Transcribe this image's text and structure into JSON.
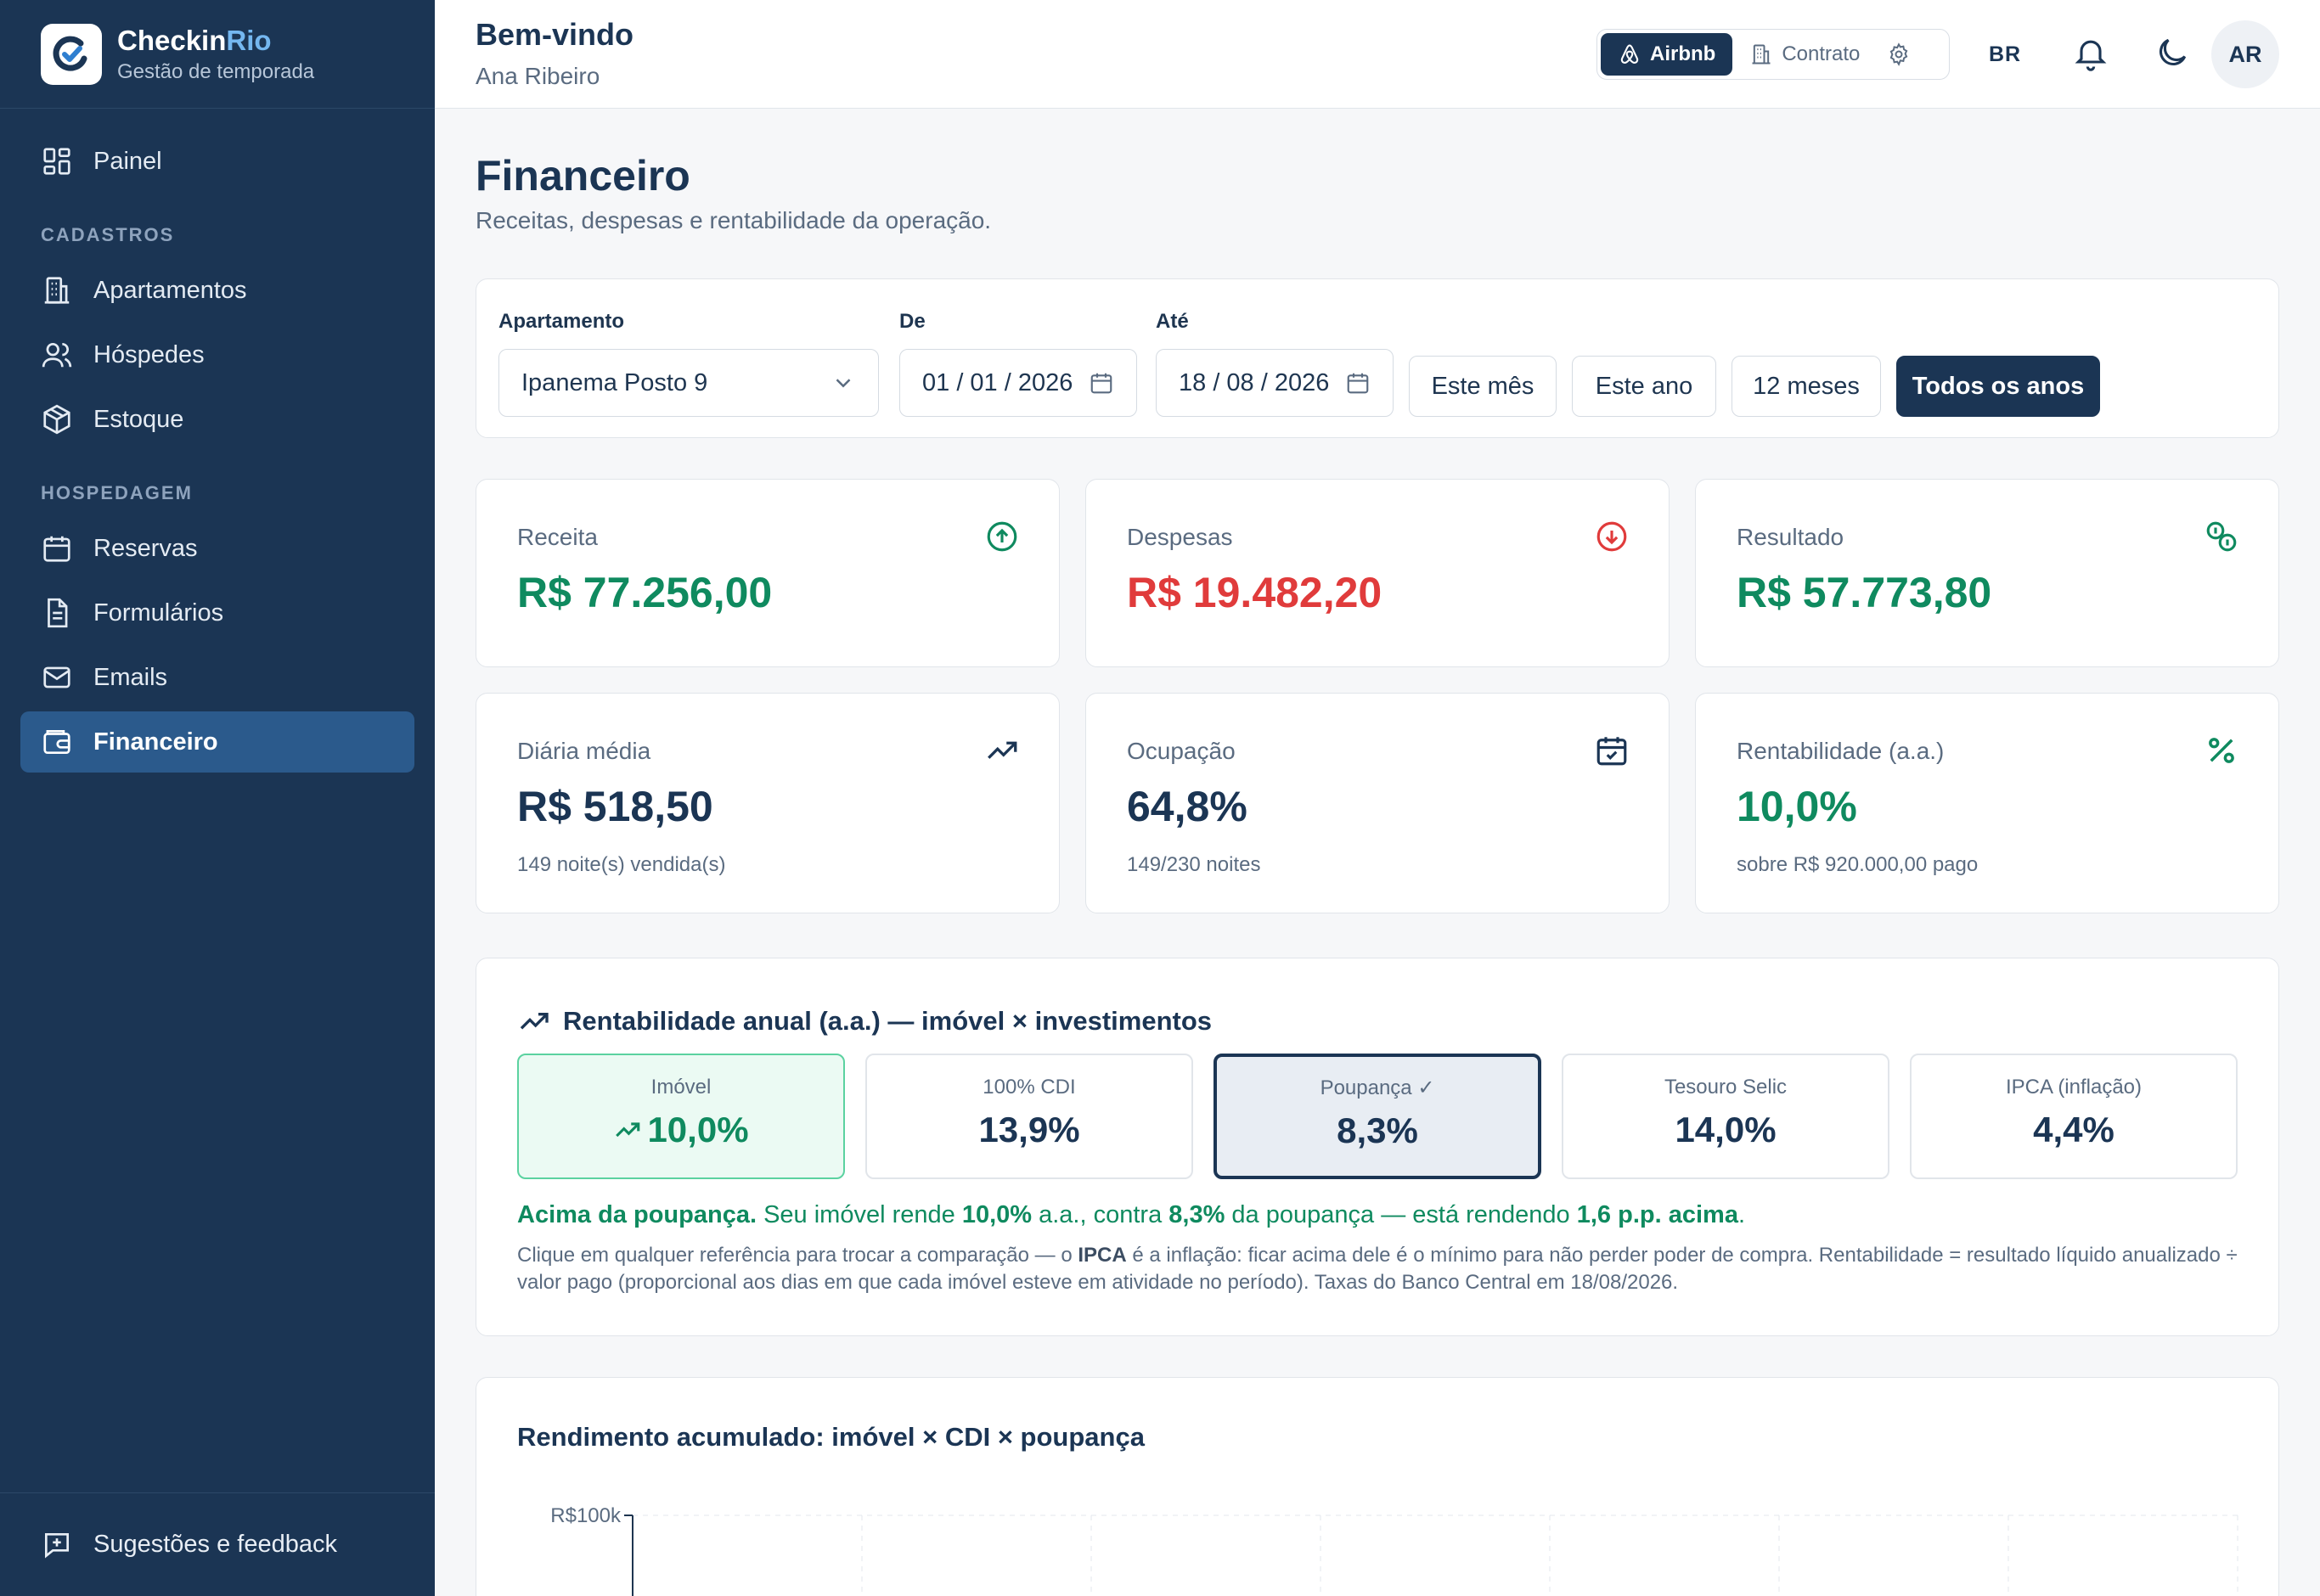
{
  "brand": {
    "name_main": "Checkin",
    "name_accent": "Rio",
    "subtitle": "Gestão de temporada"
  },
  "sidebar": {
    "top_items": [
      {
        "label": "Painel",
        "icon": "dashboard-icon"
      }
    ],
    "sections": [
      {
        "title": "CADASTROS",
        "items": [
          {
            "label": "Apartamentos",
            "icon": "building-icon"
          },
          {
            "label": "Hóspedes",
            "icon": "users-icon"
          },
          {
            "label": "Estoque",
            "icon": "package-icon"
          }
        ]
      },
      {
        "title": "HOSPEDAGEM",
        "items": [
          {
            "label": "Reservas",
            "icon": "calendar-icon"
          },
          {
            "label": "Formulários",
            "icon": "document-icon"
          },
          {
            "label": "Emails",
            "icon": "mail-icon"
          },
          {
            "label": "Financeiro",
            "icon": "wallet-icon",
            "active": true
          }
        ]
      }
    ],
    "footer": {
      "label": "Sugestões e feedback",
      "icon": "feedback-icon"
    }
  },
  "header": {
    "welcome": "Bem-vindo",
    "user": "Ana Ribeiro",
    "modes": [
      {
        "label": "Airbnb",
        "active": true
      },
      {
        "label": "Contrato",
        "active": false
      }
    ],
    "lang": "BR",
    "avatar_initials": "AR"
  },
  "page": {
    "title": "Financeiro",
    "subtitle": "Receitas, despesas e rentabilidade da operação."
  },
  "filters": {
    "apartment_label": "Apartamento",
    "apartment_value": "Ipanema Posto 9",
    "from_label": "De",
    "from_value": "01 / 01 / 2026",
    "to_label": "Até",
    "to_value": "18 / 08 / 2026",
    "quick": [
      {
        "label": "Este mês",
        "active": false
      },
      {
        "label": "Este ano",
        "active": false
      },
      {
        "label": "12 meses",
        "active": false
      },
      {
        "label": "Todos os anos",
        "active": true
      }
    ]
  },
  "stats": {
    "receita": {
      "label": "Receita",
      "value": "R$ 77.256,00"
    },
    "despesas": {
      "label": "Despesas",
      "value": "R$ 19.482,20"
    },
    "resultado": {
      "label": "Resultado",
      "value": "R$ 57.773,80"
    },
    "diaria": {
      "label": "Diária média",
      "value": "R$ 518,50",
      "sub": "149 noite(s) vendida(s)"
    },
    "ocupacao": {
      "label": "Ocupação",
      "value": "64,8%",
      "sub": "149/230 noites"
    },
    "rentabilidade": {
      "label": "Rentabilidade (a.a.)",
      "value": "10,0%",
      "sub": "sobre R$ 920.000,00 pago"
    }
  },
  "rent": {
    "title": "Rentabilidade anual (a.a.) — imóvel × investimentos",
    "refs": [
      {
        "label": "Imóvel",
        "value": "10,0%"
      },
      {
        "label": "100% CDI",
        "value": "13,9%"
      },
      {
        "label": "Poupança ✓",
        "value": "8,3%"
      },
      {
        "label": "Tesouro Selic",
        "value": "14,0%"
      },
      {
        "label": "IPCA (inflação)",
        "value": "4,4%"
      }
    ],
    "msg": {
      "lead": "Acima da poupança.",
      "p1": " Seu imóvel rende ",
      "v1": "10,0%",
      "p2": " a.a., contra ",
      "v2": "8,3%",
      "p3": " da poupança — está rendendo ",
      "v3": "1,6 p.p. acima",
      "p4": "."
    },
    "note": {
      "p1": "Clique em qualquer referência para trocar a comparação — o ",
      "b1": "IPCA",
      "p2": " é a inflação: ficar acima dele é o mínimo para não perder poder de compra. Rentabilidade = resultado líquido anualizado ÷ valor pago (proporcional aos dias em que cada imóvel esteve em atividade no período). Taxas do Banco Central em 18/08/2026."
    }
  },
  "chart_data": {
    "type": "line",
    "title": "Rendimento acumulado: imóvel × CDI × poupança",
    "ytick_labels": [
      "R$100k"
    ],
    "ylim": [
      0,
      100000
    ],
    "series_color": "#2f5fd0",
    "grid": true
  },
  "colors": {
    "sidebar": "#1b3554",
    "active": "#2b5a8c",
    "green": "#0f8a5f",
    "red": "#e03b3b"
  }
}
